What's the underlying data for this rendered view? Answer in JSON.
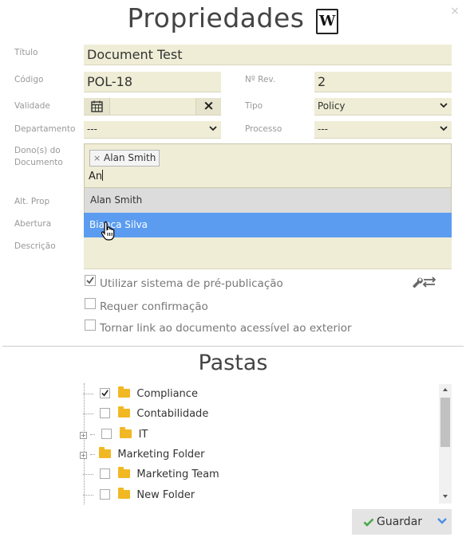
{
  "header": {
    "title": "Propriedades",
    "doc_icon_letter": "W",
    "close_label": "×"
  },
  "form": {
    "titulo_label": "Título",
    "titulo_value": "Document Test",
    "codigo_label": "Código",
    "codigo_value": "POL-18",
    "rev_label": "Nº Rev.",
    "rev_value": "2",
    "validade_label": "Validade",
    "validade_value": "",
    "clear_icon": "×",
    "tipo_label": "Tipo",
    "tipo_value": "Policy",
    "departamento_label": "Departamento",
    "departamento_value": "---",
    "processo_label": "Processo",
    "processo_value": "---",
    "donos_label": "Dono(s) do Documento",
    "owner_chip": "Alan Smith",
    "owner_chip_remove": "×",
    "owner_search_value": "An",
    "alt_prop_label": "Alt. Prop",
    "abertura_label": "Abertura",
    "descricao_label": "Descrição"
  },
  "dropdown": {
    "items": [
      {
        "label": "Alan Smith",
        "state": "hover"
      },
      {
        "label": "Bianca Silva",
        "state": "selected"
      }
    ],
    "hover_color": "#dcdcdc",
    "selected_color": "#5b9cf0"
  },
  "options": {
    "prepub_label": "Utilizar sistema de pré-publicação",
    "prepub_checked": true,
    "confirm_label": "Requer confirmação",
    "confirm_checked": false,
    "external_label": "Tornar link ao documento acessível ao exterior",
    "external_checked": false,
    "tools_icon": "wrench-swap-icon"
  },
  "pastas": {
    "title": "Pastas",
    "folders": [
      {
        "label": "Compliance",
        "checked": true,
        "expander": false,
        "checkbox": true
      },
      {
        "label": "Contabilidade",
        "checked": false,
        "expander": false,
        "checkbox": true
      },
      {
        "label": "IT",
        "checked": false,
        "expander": true,
        "checkbox": true
      },
      {
        "label": "Marketing Folder",
        "checked": false,
        "expander": true,
        "checkbox": false
      },
      {
        "label": "Marketing Team",
        "checked": false,
        "expander": false,
        "checkbox": true
      },
      {
        "label": "New Folder",
        "checked": false,
        "expander": false,
        "checkbox": true
      }
    ]
  },
  "footer": {
    "save_label": "Guardar"
  },
  "colors": {
    "field_bg": "#efedd6",
    "accent": "#5b9cf0",
    "check_green": "#4aa84a"
  }
}
